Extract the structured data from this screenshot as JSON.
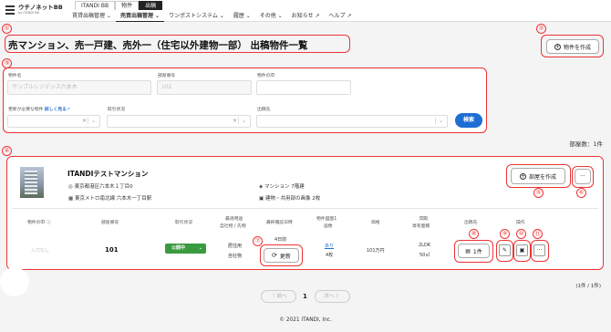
{
  "topbar": {
    "logo_main": "ウチノネットBB",
    "logo_sub": "by ITANDI BB",
    "tabs": [
      "ITANDI BB",
      "物件",
      "出稿"
    ],
    "nav": [
      "賃貸出稿管理 ⌄",
      "売買出稿管理 ⌄",
      "ワンポストシステム ⌄",
      "履歴 ⌄",
      "その他 ⌄",
      "お知らせ ↗",
      "ヘルプ ↗"
    ]
  },
  "annotations": [
    "①",
    "②",
    "③",
    "④",
    "⑤",
    "⑥",
    "⑦",
    "⑧",
    "⑨",
    "⑩",
    "⑪"
  ],
  "page": {
    "title": "売マンション、売一戸建、売外一（住宅以外建物一部） 出稿物件一覧",
    "create_property_button": "物件を作成"
  },
  "search": {
    "property_name_label": "物件名",
    "property_name_placeholder": "サンプルレジデンス六本木",
    "room_number_label": "部屋番号",
    "room_number_placeholder": "102",
    "property_id_label": "物件のID",
    "update_required_label": "更新が必要な物件",
    "details_link": "詳しく見る",
    "status_label": "取引状況",
    "publish_to_label": "出稿先",
    "search_button": "検索"
  },
  "results": {
    "room_count": "部屋数：1件",
    "rows_info": "(1件 / 1件)"
  },
  "card": {
    "property_name": "ITANDIテストマンション",
    "address": "東京都港区六本木１丁目0",
    "station": "東京メトロ南北線 六本木一丁目駅",
    "building_type": "マンション 7階建",
    "images": "建物・共用部の画像 2枚",
    "create_room_button": "部屋を作成",
    "more_button": "···",
    "columns": [
      "物件のID ⓘ",
      "部屋番号",
      "取引状況",
      "最適用途",
      "自社物 / 先物",
      "最終確認日時",
      "物件図面1",
      "画像",
      "価格",
      "間取",
      "専有面積",
      "出稿先",
      "操作"
    ],
    "row": {
      "property_id": "入力なし",
      "room_number": "101",
      "status": "公開中",
      "usage": "居住用",
      "ownership": "自社物",
      "confirm_date": "4日前",
      "update_button": "更新",
      "floorplan_link": "あり",
      "image_count": "4枚",
      "price": "101万円",
      "layout": "2LDK",
      "area": "50㎡",
      "publish_count": "1件",
      "edit_icon": "✎",
      "image_icon": "▣",
      "more_icon": "···"
    }
  },
  "pagination": {
    "prev": "〈 前へ",
    "current": "1",
    "next": "次へ 〉"
  },
  "footer": "© 2021 ITANDI, Inc."
}
